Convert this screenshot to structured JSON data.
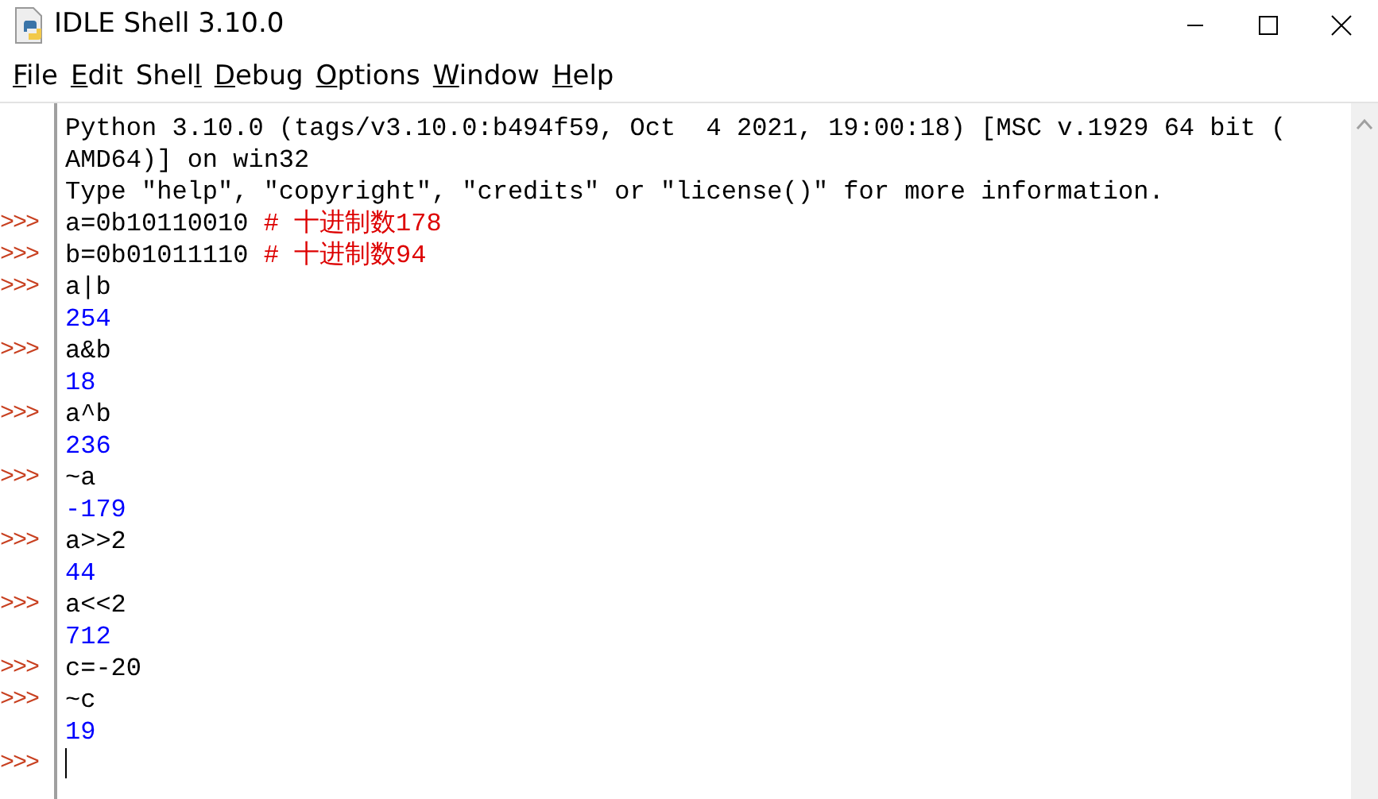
{
  "window": {
    "title": "IDLE Shell 3.10.0"
  },
  "menu": [
    {
      "key": "F",
      "rest": "ile"
    },
    {
      "key": "E",
      "rest": "dit"
    },
    {
      "before": "Shel",
      "key": "l"
    },
    {
      "key": "D",
      "rest": "ebug"
    },
    {
      "key": "O",
      "rest": "ptions"
    },
    {
      "key": "W",
      "rest": "indow"
    },
    {
      "key": "H",
      "rest": "elp"
    }
  ],
  "shell_lines": [
    {
      "kind": "banner",
      "text": "Python 3.10.0 (tags/v3.10.0:b494f59, Oct  4 2021, 19:00:18) [MSC v.1929 64 bit ("
    },
    {
      "kind": "banner",
      "text": "AMD64)] on win32"
    },
    {
      "kind": "banner",
      "text": "Type \"help\", \"copyright\", \"credits\" or \"license()\" for more information."
    },
    {
      "kind": "input",
      "prompt": ">>>",
      "text": "a=0b10110010 ",
      "comment": "# 十进制数178"
    },
    {
      "kind": "input",
      "prompt": ">>>",
      "text": "b=0b01011110 ",
      "comment": "# 十进制数94"
    },
    {
      "kind": "input",
      "prompt": ">>>",
      "text": "a|b"
    },
    {
      "kind": "output",
      "text": "254"
    },
    {
      "kind": "input",
      "prompt": ">>>",
      "text": "a&b"
    },
    {
      "kind": "output",
      "text": "18"
    },
    {
      "kind": "input",
      "prompt": ">>>",
      "text": "a^b"
    },
    {
      "kind": "output",
      "text": "236"
    },
    {
      "kind": "input",
      "prompt": ">>>",
      "text": "~a"
    },
    {
      "kind": "output",
      "text": "-179"
    },
    {
      "kind": "input",
      "prompt": ">>>",
      "text": "a>>2"
    },
    {
      "kind": "output",
      "text": "44"
    },
    {
      "kind": "input",
      "prompt": ">>>",
      "text": "a<<2"
    },
    {
      "kind": "output",
      "text": "712"
    },
    {
      "kind": "input",
      "prompt": ">>>",
      "text": "c=-20"
    },
    {
      "kind": "input",
      "prompt": ">>>",
      "text": "~c"
    },
    {
      "kind": "output",
      "text": "19"
    },
    {
      "kind": "cursor",
      "prompt": ">>>"
    }
  ]
}
